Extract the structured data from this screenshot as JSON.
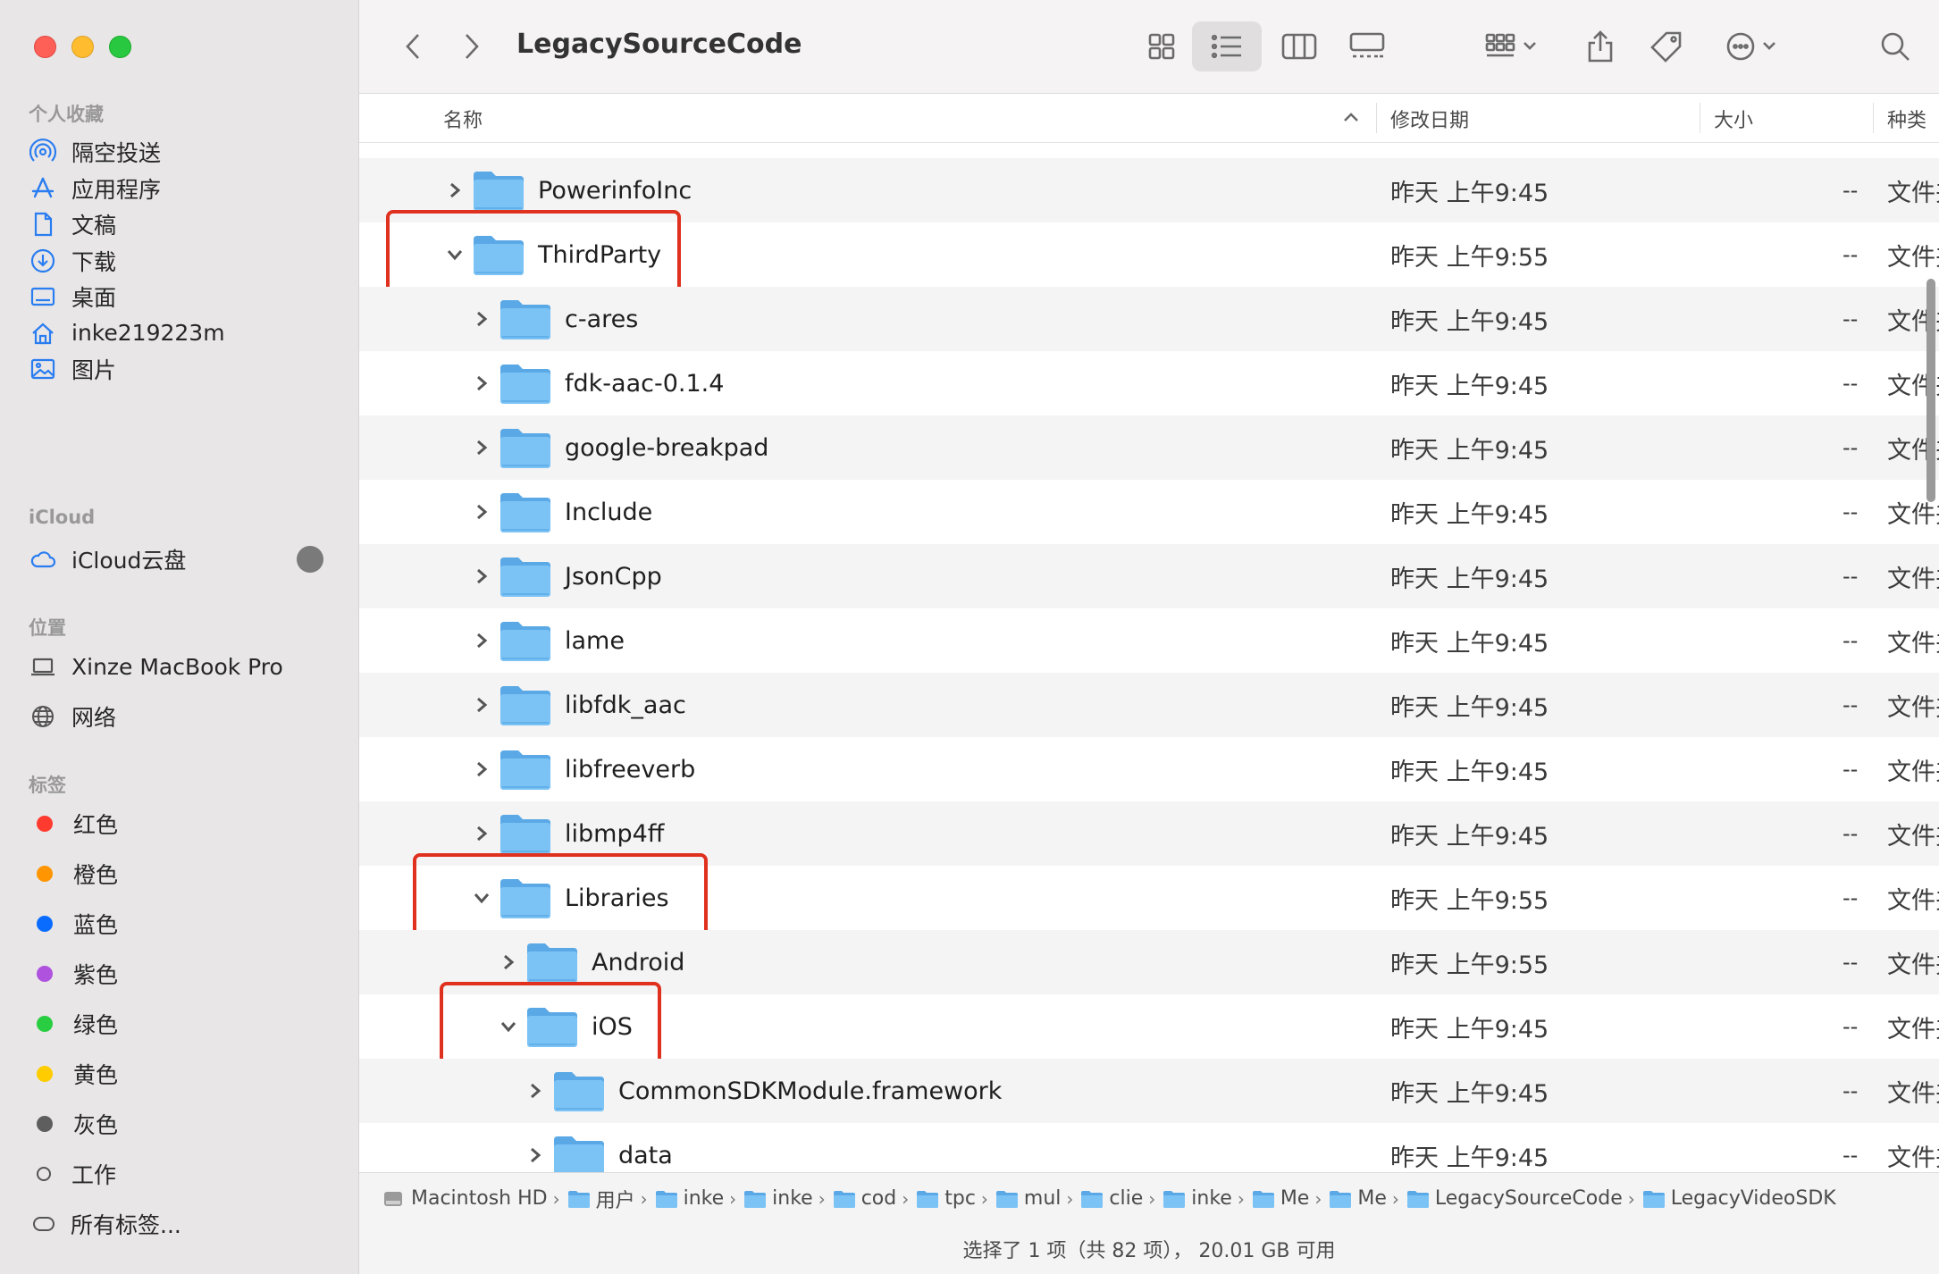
{
  "sidebar": {
    "favorites_header": "个人收藏",
    "favorites": [
      {
        "label": "隔空投送",
        "icon": "airdrop-icon"
      },
      {
        "label": "应用程序",
        "icon": "applications-icon"
      },
      {
        "label": "文稿",
        "icon": "document-icon"
      },
      {
        "label": "下载",
        "icon": "download-icon"
      },
      {
        "label": "桌面",
        "icon": "desktop-icon"
      },
      {
        "label": "inke219223m",
        "icon": "home-icon"
      },
      {
        "label": "图片",
        "icon": "photo-icon"
      }
    ],
    "icloud_header": "iCloud",
    "icloud": [
      {
        "label": "iCloud云盘",
        "icon": "cloud-icon"
      }
    ],
    "locations_header": "位置",
    "locations": [
      {
        "label": "Xinze MacBook Pro",
        "icon": "laptop-icon"
      },
      {
        "label": "网络",
        "icon": "globe-icon"
      }
    ],
    "tags_header": "标签",
    "tags": [
      {
        "label": "红色",
        "color": "#ff3b30"
      },
      {
        "label": "橙色",
        "color": "#ff9500"
      },
      {
        "label": "蓝色",
        "color": "#0a6cff"
      },
      {
        "label": "紫色",
        "color": "#af52de"
      },
      {
        "label": "绿色",
        "color": "#28cd41"
      },
      {
        "label": "黄色",
        "color": "#ffcc00"
      },
      {
        "label": "灰色",
        "color": "#5e5e5e"
      },
      {
        "label": "工作",
        "color": ""
      },
      {
        "label": "所有标签...",
        "color": "all"
      }
    ]
  },
  "toolbar": {
    "title": "LegacySourceCode"
  },
  "columns": {
    "name": "名称",
    "date": "修改日期",
    "size": "大小",
    "kind": "种类"
  },
  "rows": [
    {
      "name": "PowerinfoInc",
      "date": "昨天 上午9:45",
      "size": "--",
      "kind": "文件夹",
      "level": 0,
      "expanded": false
    },
    {
      "name": "ThirdParty",
      "date": "昨天 上午9:55",
      "size": "--",
      "kind": "文件夹",
      "level": 0,
      "expanded": true
    },
    {
      "name": "c-ares",
      "date": "昨天 上午9:45",
      "size": "--",
      "kind": "文件夹",
      "level": 1,
      "expanded": false
    },
    {
      "name": "fdk-aac-0.1.4",
      "date": "昨天 上午9:45",
      "size": "--",
      "kind": "文件夹",
      "level": 1,
      "expanded": false
    },
    {
      "name": "google-breakpad",
      "date": "昨天 上午9:45",
      "size": "--",
      "kind": "文件夹",
      "level": 1,
      "expanded": false
    },
    {
      "name": "Include",
      "date": "昨天 上午9:45",
      "size": "--",
      "kind": "文件夹",
      "level": 1,
      "expanded": false
    },
    {
      "name": "JsonCpp",
      "date": "昨天 上午9:45",
      "size": "--",
      "kind": "文件夹",
      "level": 1,
      "expanded": false
    },
    {
      "name": "lame",
      "date": "昨天 上午9:45",
      "size": "--",
      "kind": "文件夹",
      "level": 1,
      "expanded": false
    },
    {
      "name": "libfdk_aac",
      "date": "昨天 上午9:45",
      "size": "--",
      "kind": "文件夹",
      "level": 1,
      "expanded": false
    },
    {
      "name": "libfreeverb",
      "date": "昨天 上午9:45",
      "size": "--",
      "kind": "文件夹",
      "level": 1,
      "expanded": false
    },
    {
      "name": "libmp4ff",
      "date": "昨天 上午9:45",
      "size": "--",
      "kind": "文件夹",
      "level": 1,
      "expanded": false
    },
    {
      "name": "Libraries",
      "date": "昨天 上午9:55",
      "size": "--",
      "kind": "文件夹",
      "level": 1,
      "expanded": true
    },
    {
      "name": "Android",
      "date": "昨天 上午9:55",
      "size": "--",
      "kind": "文件夹",
      "level": 2,
      "expanded": false
    },
    {
      "name": "iOS",
      "date": "昨天 上午9:45",
      "size": "--",
      "kind": "文件夹",
      "level": 2,
      "expanded": true
    },
    {
      "name": "CommonSDKModule.framework",
      "date": "昨天 上午9:45",
      "size": "--",
      "kind": "文件夹",
      "level": 3,
      "expanded": false
    },
    {
      "name": "data",
      "date": "昨天 上午9:45",
      "size": "--",
      "kind": "文件夹",
      "level": 3,
      "expanded": false
    }
  ],
  "highlighted_rows": [
    "ThirdParty",
    "Libraries",
    "iOS"
  ],
  "pathbar": [
    {
      "label": "Macintosh HD",
      "icon": "disk-icon"
    },
    {
      "label": "用户",
      "icon": "folder-icon"
    },
    {
      "label": "inke",
      "icon": "home-folder-icon"
    },
    {
      "label": "inke",
      "icon": "folder-icon"
    },
    {
      "label": "cod",
      "icon": "folder-icon"
    },
    {
      "label": "tpc",
      "icon": "folder-icon"
    },
    {
      "label": "mul",
      "icon": "folder-icon"
    },
    {
      "label": "clie",
      "icon": "folder-icon"
    },
    {
      "label": "inke",
      "icon": "folder-icon"
    },
    {
      "label": "Me",
      "icon": "folder-icon"
    },
    {
      "label": "Me",
      "icon": "folder-icon"
    },
    {
      "label": "LegacySourceCode",
      "icon": "folder-icon"
    },
    {
      "label": "LegacyVideoSDK",
      "icon": "folder-icon"
    }
  ],
  "status": "选择了 1 项（共 82 项）， 20.01 GB 可用",
  "colors": {
    "folder": "#7cc3f5",
    "folder_dark": "#5aa9e6",
    "highlight": "#e0301e",
    "accent": "#2a7df0"
  }
}
